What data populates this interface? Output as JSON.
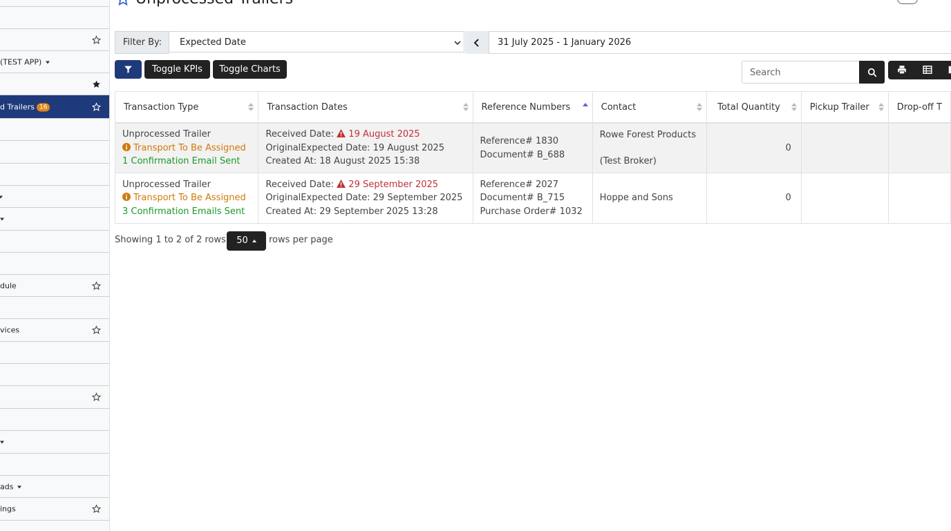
{
  "sidebar": {
    "items": [
      {
        "label": "",
        "star": false
      },
      {
        "label": "",
        "star": true
      },
      {
        "label": "(TEST APP)",
        "caret": true
      },
      {
        "label": "",
        "star": "filled"
      },
      {
        "label": "d Trailers",
        "badge": "16",
        "star": true,
        "active": true
      },
      {
        "label": ""
      },
      {
        "label": ""
      },
      {
        "label": "",
        "caret": true
      },
      {
        "label": "",
        "caret": true
      },
      {
        "label": ""
      },
      {
        "label": ""
      },
      {
        "label": "dule",
        "star": true
      },
      {
        "label": ""
      },
      {
        "label": "vices",
        "star": true
      },
      {
        "label": ""
      },
      {
        "label": ""
      },
      {
        "label": "",
        "star": true
      },
      {
        "label": ""
      },
      {
        "label": "",
        "caret": true
      },
      {
        "label": ""
      },
      {
        "label": "ads",
        "caret": true
      },
      {
        "label": "ings",
        "star": true
      }
    ]
  },
  "header": {
    "title": "Unprocessed Trailers"
  },
  "filter": {
    "label": "Filter By:",
    "selected": "Expected Date",
    "date_range": "31 July 2025 - 1 January 2026"
  },
  "toolbar": {
    "toggle_kpis": "Toggle KPIs",
    "toggle_charts": "Toggle Charts",
    "search_placeholder": "Search"
  },
  "table": {
    "columns": [
      "Transaction Type",
      "Transaction Dates",
      "Reference Numbers",
      "Contact",
      "Total Quantity",
      "Pickup Trailer",
      "Drop-off T"
    ],
    "rows": [
      {
        "type": "Unprocessed Trailer",
        "status": "Transport To Be Assigned",
        "emails": "1 Confirmation Email Sent",
        "received_label": "Received Date:",
        "received": "19 August 2025",
        "original_expected": "OriginalExpected Date: 19 August 2025",
        "created": "Created At: 18 August 2025 15:38",
        "ref1": "Reference# 1830",
        "ref2": "Document# B_688",
        "ref3": "",
        "contact1": "Rowe Forest Products",
        "contact2": "(Test Broker)",
        "quantity": "0"
      },
      {
        "type": "Unprocessed Trailer",
        "status": "Transport To Be Assigned",
        "emails": "3 Confirmation Emails Sent",
        "received_label": "Received Date:",
        "received": "29 September 2025",
        "original_expected": "OriginalExpected Date: 29 September 2025",
        "created": "Created At: 29 September 2025 13:28",
        "ref1": "Reference# 2027",
        "ref2": "Document# B_715",
        "ref3": "Purchase Order# 1032",
        "contact1": "Hoppe and Sons",
        "contact2": "",
        "quantity": "0"
      }
    ]
  },
  "pagination": {
    "showing": "Showing 1 to 2 of 2 rows",
    "page_size": "50",
    "rows_per_page": "rows per page"
  },
  "colors": {
    "primary": "#1f3a7a",
    "dark": "#222222",
    "warning": "#d07a0a",
    "success": "#1a9a2a",
    "danger": "#c0303a",
    "badge": "#e0861d"
  }
}
